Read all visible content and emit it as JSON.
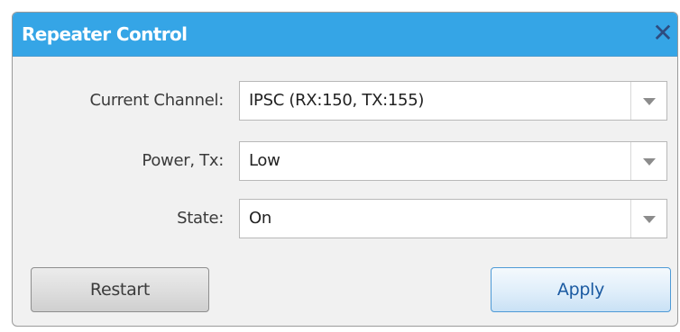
{
  "dialog": {
    "title": "Repeater Control",
    "close_icon": "close-icon",
    "close_glyph": "✕",
    "accent_color": "#35a5e6"
  },
  "fields": [
    {
      "label": "Current Channel:",
      "value": "IPSC (RX:150, TX:155)"
    },
    {
      "label": "Power, Tx:",
      "value": "Low"
    },
    {
      "label": "State:",
      "value": "On"
    }
  ],
  "buttons": {
    "restart_label": "Restart",
    "apply_label": "Apply"
  }
}
